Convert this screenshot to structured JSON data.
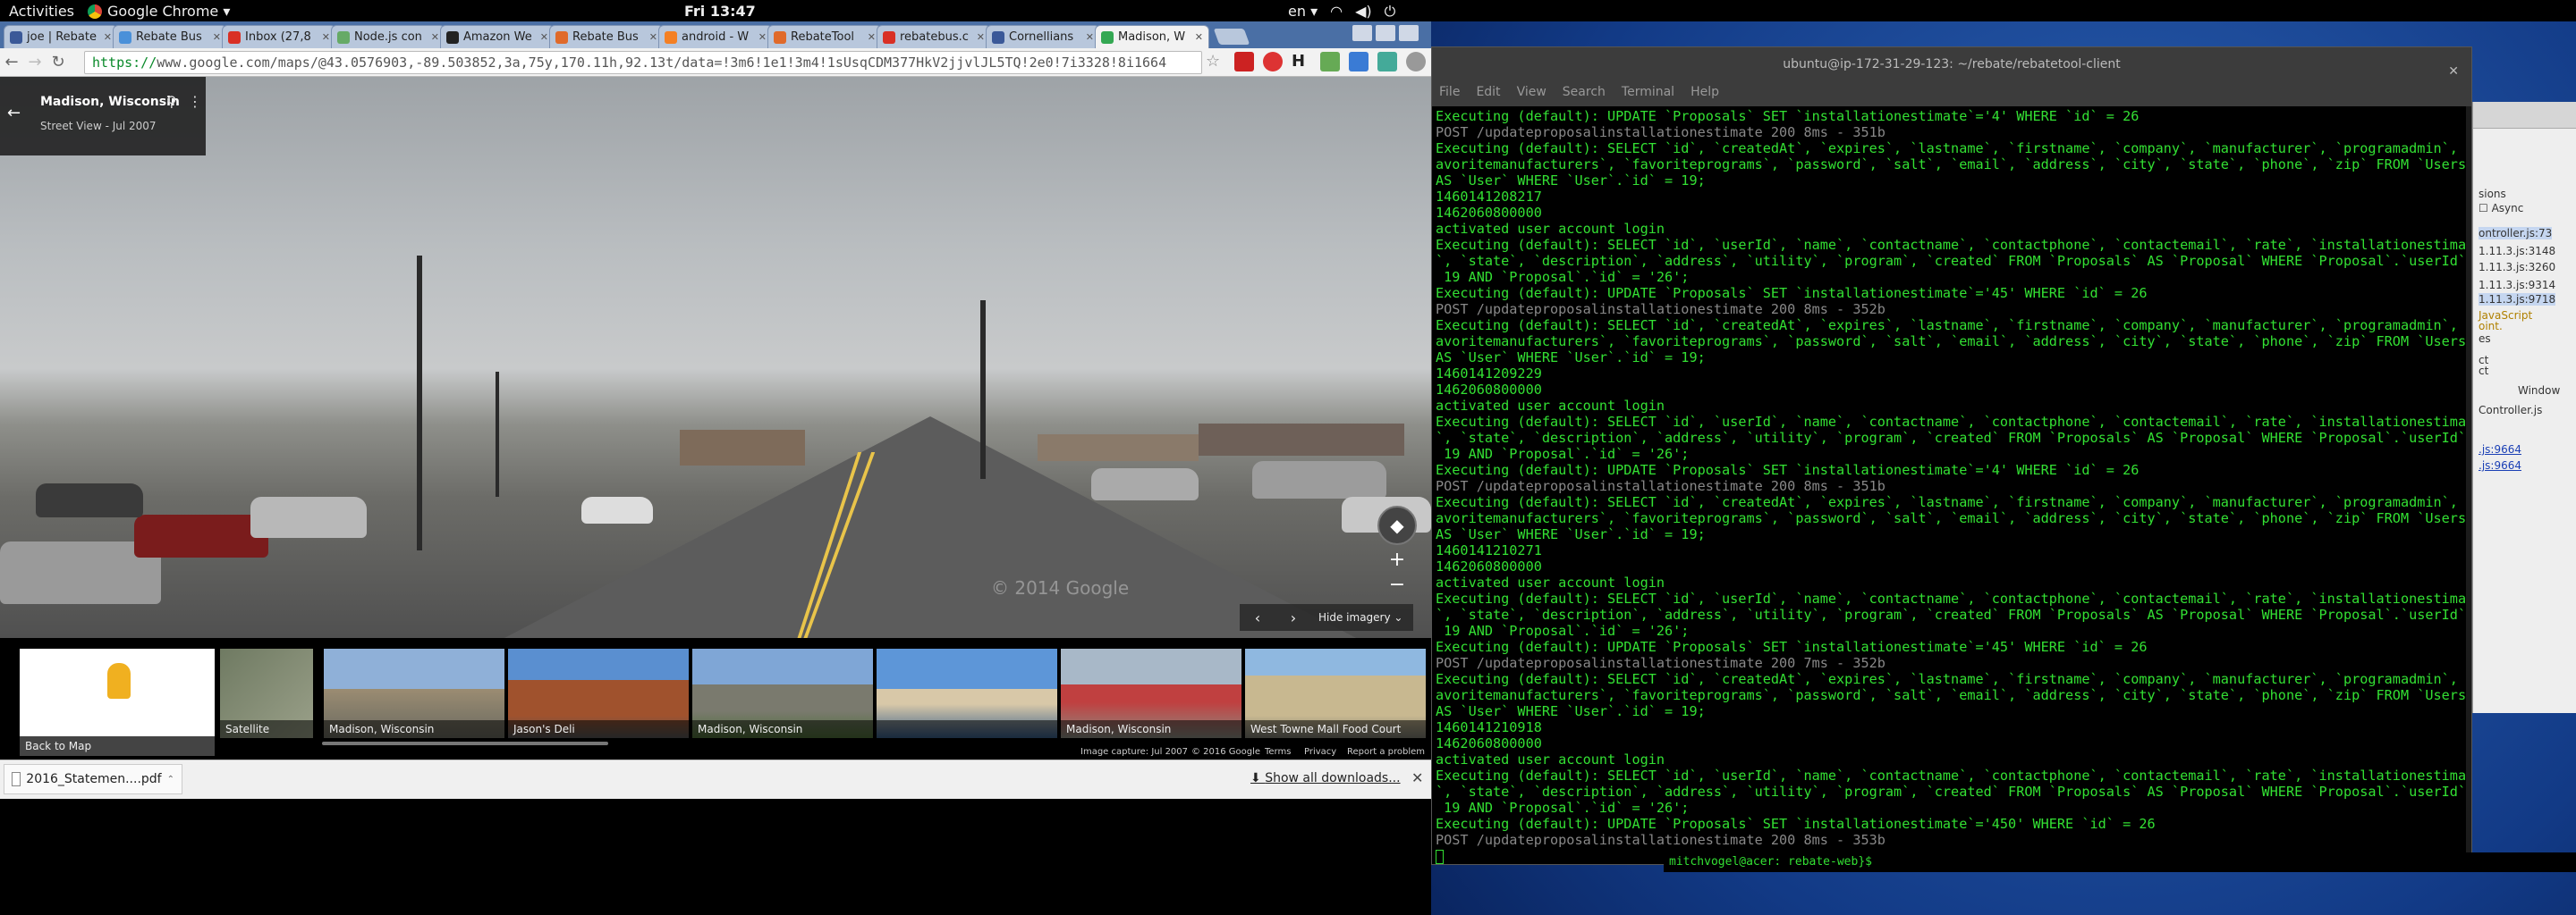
{
  "topbar": {
    "activities": "Activities",
    "app": "Google Chrome ▾",
    "clock": "Fri 13:47",
    "lang": "en ▾"
  },
  "tabs": [
    {
      "label": "joe | Rebate",
      "color": "#3b5998"
    },
    {
      "label": "Rebate Bus",
      "color": "#4a90d9"
    },
    {
      "label": "Inbox (27,8",
      "color": "#d93025"
    },
    {
      "label": "Node.js con",
      "color": "#6a6"
    },
    {
      "label": "Amazon We",
      "color": "#222"
    },
    {
      "label": "Rebate Bus",
      "color": "#e06a2a"
    },
    {
      "label": "android - W",
      "color": "#f48024"
    },
    {
      "label": "RebateTool",
      "color": "#e06a2a"
    },
    {
      "label": "rebatebus.c",
      "color": "#d93025"
    },
    {
      "label": "Cornellians",
      "color": "#3b5998"
    },
    {
      "label": "Madison, W",
      "color": "#34a853",
      "active": true
    }
  ],
  "omnibox": {
    "scheme": "https://",
    "url": "www.google.com/maps/@43.0576903,-89.503852,3a,75y,170.11h,92.13t/data=!3m6!1e1!3m4!1sUsqCDM377HkV2jjvlJL5TQ!2e0!7i3328!8i1664"
  },
  "streetview": {
    "place": "Madison, Wisconsin",
    "subtitle": "Street View - Jul 2007",
    "hide_imagery": "Hide imagery",
    "watermark": "© 2014 Google"
  },
  "strip": {
    "back_to_map": "Back to Map",
    "thumbs": [
      "Satellite",
      "Madison, Wisconsin",
      "Jason's Deli",
      "Madison, Wisconsin",
      "",
      "Madison, Wisconsin",
      "West Towne Mall Food Court"
    ],
    "footer": [
      "Image capture: Jul 2007",
      "© 2016 Google",
      "Terms",
      "Privacy",
      "Report a problem"
    ]
  },
  "downloads": {
    "file": "2016_Statemen....pdf",
    "show_all": "Show all downloads..."
  },
  "terminal": {
    "title": "ubuntu@ip-172-31-29-123: ~/rebate/rebatetool-client",
    "menu": [
      "File",
      "Edit",
      "View",
      "Search",
      "Terminal",
      "Help"
    ],
    "lines": [
      "Executing (default): UPDATE `Proposals` SET `installationestimate`='4' WHERE `id` = 26",
      "POST /updateproposalinstallationestimate 200 8ms - 351b",
      "Executing (default): SELECT `id`, `createdAt`, `expires`, `lastname`, `firstname`, `company`, `manufacturer`, `programadmin`, `f",
      "avoritemanufacturers`, `favoriteprograms`, `password`, `salt`, `email`, `address`, `city`, `state`, `phone`, `zip` FROM `Users`",
      "AS `User` WHERE `User`.`id` = 19;",
      "1460141208217",
      "1462060800000",
      "activated user account login",
      "Executing (default): SELECT `id`, `userId`, `name`, `contactname`, `contactphone`, `contactemail`, `rate`, `installationestimate",
      "`, `state`, `description`, `address`, `utility`, `program`, `created` FROM `Proposals` AS `Proposal` WHERE `Proposal`.`userId` =",
      " 19 AND `Proposal`.`id` = '26';",
      "Executing (default): UPDATE `Proposals` SET `installationestimate`='45' WHERE `id` = 26",
      "POST /updateproposalinstallationestimate 200 8ms - 352b",
      "Executing (default): SELECT `id`, `createdAt`, `expires`, `lastname`, `firstname`, `company`, `manufacturer`, `programadmin`, `f",
      "avoritemanufacturers`, `favoriteprograms`, `password`, `salt`, `email`, `address`, `city`, `state`, `phone`, `zip` FROM `Users`",
      "AS `User` WHERE `User`.`id` = 19;",
      "1460141209229",
      "1462060800000",
      "activated user account login",
      "Executing (default): SELECT `id`, `userId`, `name`, `contactname`, `contactphone`, `contactemail`, `rate`, `installationestimate",
      "`, `state`, `description`, `address`, `utility`, `program`, `created` FROM `Proposals` AS `Proposal` WHERE `Proposal`.`userId` =",
      " 19 AND `Proposal`.`id` = '26';",
      "Executing (default): UPDATE `Proposals` SET `installationestimate`='4' WHERE `id` = 26",
      "POST /updateproposalinstallationestimate 200 8ms - 351b",
      "Executing (default): SELECT `id`, `createdAt`, `expires`, `lastname`, `firstname`, `company`, `manufacturer`, `programadmin`, `f",
      "avoritemanufacturers`, `favoriteprograms`, `password`, `salt`, `email`, `address`, `city`, `state`, `phone`, `zip` FROM `Users`",
      "AS `User` WHERE `User`.`id` = 19;",
      "1460141210271",
      "1462060800000",
      "activated user account login",
      "Executing (default): SELECT `id`, `userId`, `name`, `contactname`, `contactphone`, `contactemail`, `rate`, `installationestimate",
      "`, `state`, `description`, `address`, `utility`, `program`, `created` FROM `Proposals` AS `Proposal` WHERE `Proposal`.`userId` =",
      " 19 AND `Proposal`.`id` = '26';",
      "Executing (default): UPDATE `Proposals` SET `installationestimate`='45' WHERE `id` = 26",
      "POST /updateproposalinstallationestimate 200 7ms - 352b",
      "Executing (default): SELECT `id`, `createdAt`, `expires`, `lastname`, `firstname`, `company`, `manufacturer`, `programadmin`, `f",
      "avoritemanufacturers`, `favoriteprograms`, `password`, `salt`, `email`, `address`, `city`, `state`, `phone`, `zip` FROM `Users`",
      "AS `User` WHERE `User`.`id` = 19;",
      "1460141210918",
      "1462060800000",
      "activated user account login",
      "Executing (default): SELECT `id`, `userId`, `name`, `contactname`, `contactphone`, `contactemail`, `rate`, `installationestimate",
      "`, `state`, `description`, `address`, `utility`, `program`, `created` FROM `Proposals` AS `Proposal` WHERE `Proposal`.`userId` =",
      " 19 AND `Proposal`.`id` = '26';",
      "Executing (default): UPDATE `Proposals` SET `installationestimate`='450' WHERE `id` = 26",
      "POST /updateproposalinstallationestimate 200 8ms - 353b"
    ]
  },
  "devtools": {
    "async": "Async",
    "lines": [
      "sions",
      "ontroller.js:73",
      "1.11.3.js:3148",
      "1.11.3.js:3260",
      "1.11.3.js:9314",
      "1.11.3.js:9718",
      "JavaScript",
      "oint.",
      "es",
      "ct",
      "ct",
      "Window",
      "Controller.js",
      ".js:9664",
      ".js:9664"
    ]
  },
  "bottomterm": "mitchvogel@acer: rebate-web}$"
}
